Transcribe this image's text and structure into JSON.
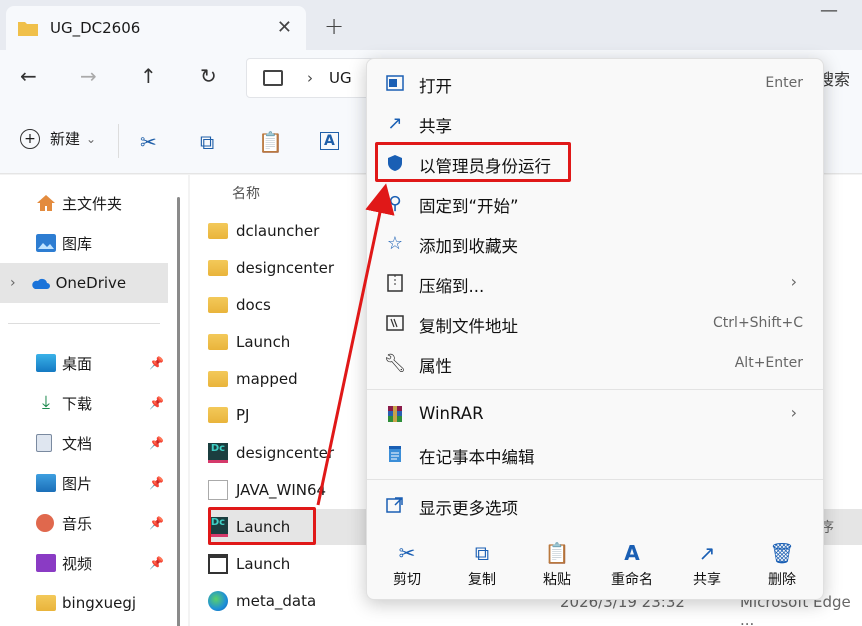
{
  "tab": {
    "title": "UG_DC2606",
    "close": "✕",
    "add": "+"
  },
  "window": {
    "minimize": "—"
  },
  "nav": {
    "back": "←",
    "forward": "→",
    "up": "↑",
    "refresh": "↻",
    "breadcrumb_sep": "›",
    "address_partial": "UG",
    "search_hint_partial": "搜索"
  },
  "toolbar": {
    "new_label": "新建",
    "new_caret": "⌄",
    "cut": "✂",
    "copy": "⧉",
    "paste": "📋",
    "rename": "A",
    "share_partial": "⃞"
  },
  "sidebar": {
    "items": [
      {
        "label": "主文件夹",
        "icon": "home-icon"
      },
      {
        "label": "图库",
        "icon": "gallery-icon"
      },
      {
        "label": "OneDrive",
        "icon": "onedrive-icon",
        "chevron": "›"
      },
      {
        "label": "桌面",
        "icon": "desktop-icon",
        "pin": "📌"
      },
      {
        "label": "下载",
        "icon": "download-icon",
        "pin": "📌"
      },
      {
        "label": "文档",
        "icon": "document-icon",
        "pin": "📌"
      },
      {
        "label": "图片",
        "icon": "pictures-icon",
        "pin": "📌"
      },
      {
        "label": "音乐",
        "icon": "music-icon",
        "pin": "📌"
      },
      {
        "label": "视频",
        "icon": "video-icon",
        "pin": "📌"
      },
      {
        "label": "bingxuegj",
        "icon": "folder-icon"
      }
    ]
  },
  "files": {
    "column_name": "名称",
    "rows": [
      {
        "name": "dclauncher",
        "kind": "folder"
      },
      {
        "name": "designcenter",
        "kind": "folder"
      },
      {
        "name": "docs",
        "kind": "folder"
      },
      {
        "name": "Launch",
        "kind": "folder"
      },
      {
        "name": "mapped",
        "kind": "folder"
      },
      {
        "name": "PJ",
        "kind": "folder"
      },
      {
        "name": "designcenter",
        "kind": "dc"
      },
      {
        "name": "JAVA_WIN64",
        "kind": "java"
      },
      {
        "name": "Launch",
        "kind": "dc",
        "selected": true
      },
      {
        "name": "Launch",
        "kind": "exe"
      },
      {
        "name": "meta_data",
        "kind": "edge",
        "date_partial": "2026/3/19 23:32",
        "type_partial": "Microsoft Edge ..."
      }
    ],
    "launch_type_partial": "序"
  },
  "context_menu": {
    "items": [
      {
        "label": "打开",
        "icon": "open-icon",
        "shortcut": "Enter"
      },
      {
        "label": "共享",
        "icon": "share-icon",
        "shortcut": ""
      },
      {
        "label": "以管理员身份运行",
        "icon": "shield-icon",
        "shortcut": ""
      },
      {
        "label": "固定到“开始”",
        "icon": "pin-icon",
        "shortcut": ""
      },
      {
        "label": "添加到收藏夹",
        "icon": "star-icon",
        "shortcut": ""
      },
      {
        "label": "压缩到...",
        "icon": "zip-icon",
        "shortcut": "",
        "submenu": "›"
      },
      {
        "label": "复制文件地址",
        "icon": "copy-path-icon",
        "shortcut": "Ctrl+Shift+C"
      },
      {
        "label": "属性",
        "icon": "wrench-icon",
        "shortcut": "Alt+Enter"
      },
      {
        "label": "WinRAR",
        "icon": "winrar-icon",
        "shortcut": "",
        "submenu": "›"
      },
      {
        "label": "在记事本中编辑",
        "icon": "notepad-icon",
        "shortcut": ""
      },
      {
        "label": "显示更多选项",
        "icon": "more-options-icon",
        "shortcut": ""
      }
    ],
    "bottom": [
      {
        "label": "剪切",
        "icon": "✂"
      },
      {
        "label": "复制",
        "icon": "⧉"
      },
      {
        "label": "粘贴",
        "icon": "📋"
      },
      {
        "label": "重命名",
        "icon": "A"
      },
      {
        "label": "共享",
        "icon": "↗"
      },
      {
        "label": "删除",
        "icon": "🗑"
      }
    ]
  },
  "colors": {
    "highlight": "#e01818",
    "accent": "#1a5fb4",
    "selected_row": "#e5e5e5"
  }
}
